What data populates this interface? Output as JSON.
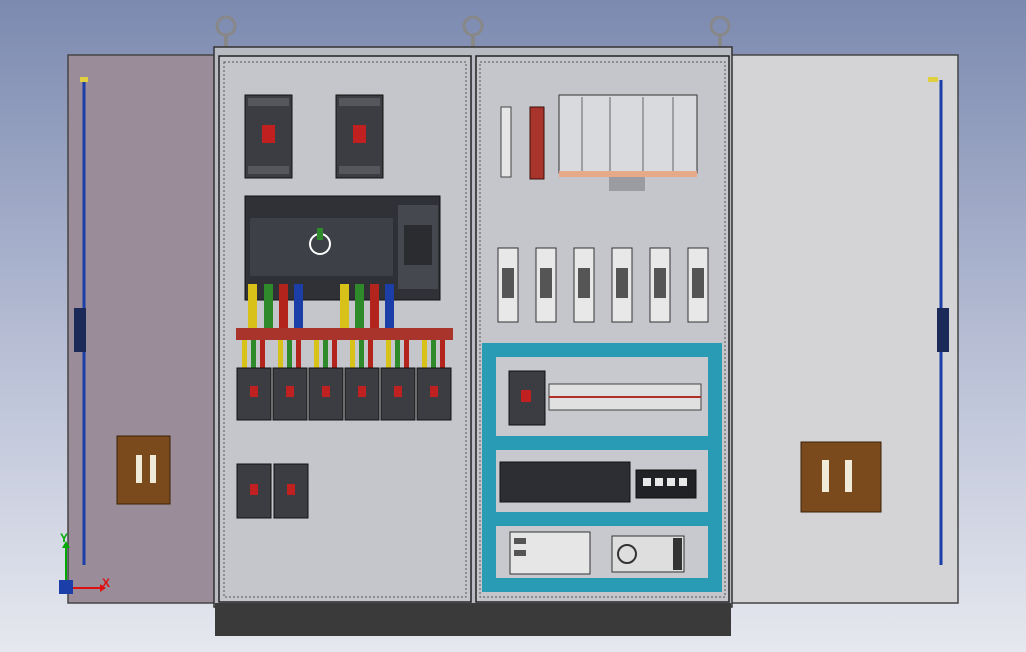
{
  "scene": {
    "description_hidden": "",
    "axis": {
      "x_label": "X",
      "y_label": "Y"
    }
  },
  "colors": {
    "bg_top": "#7c8ab0",
    "left_door": "#9a8c98",
    "right_door": "#d4d4d6",
    "panel": "#c7c9ce",
    "cable_yellow": "#d8c21a",
    "cable_green": "#2e8a2a",
    "cable_red": "#b3241c",
    "cable_blue": "#1c3ea8",
    "busbar": "#a8342c",
    "dinrail_cyan": "#2a9bb5",
    "handle_brown": "#7a4a1c"
  },
  "toolbar": {}
}
